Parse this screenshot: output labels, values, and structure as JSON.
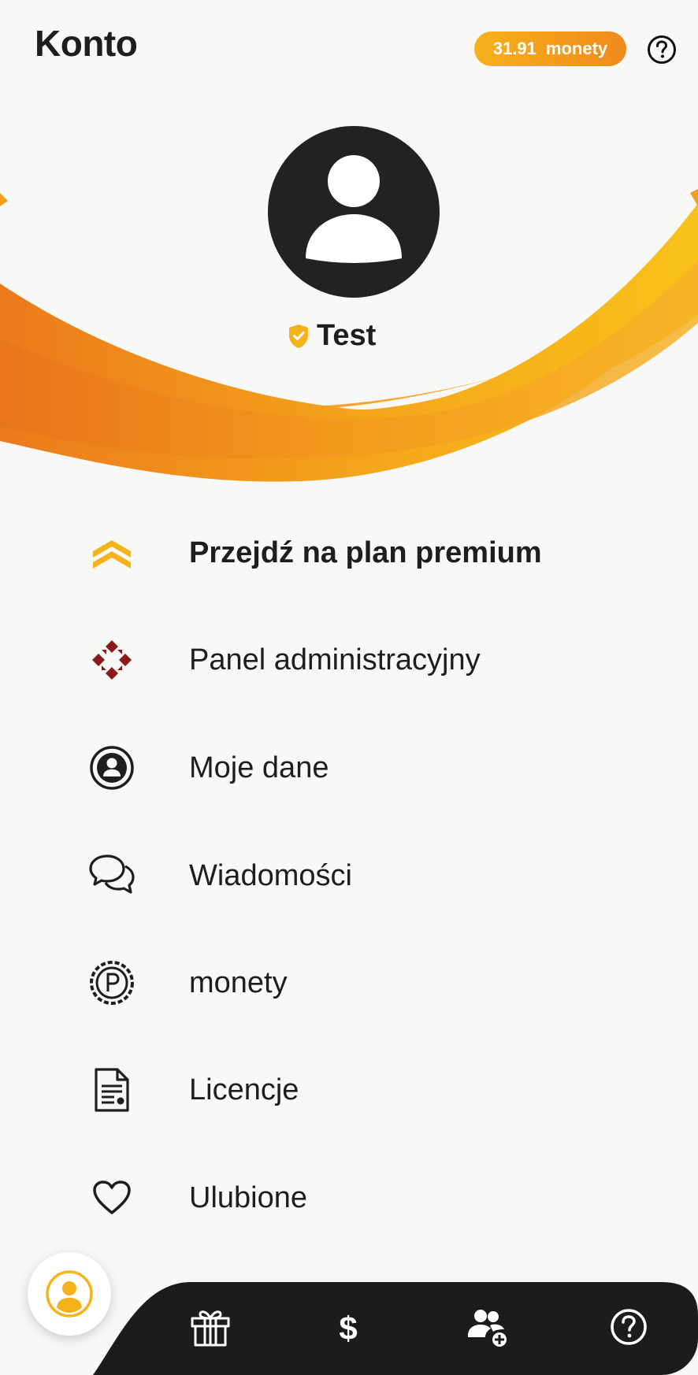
{
  "header": {
    "title": "Konto",
    "coins_value": "31.91",
    "coins_unit": "monety"
  },
  "profile": {
    "name": "Test"
  },
  "menu": {
    "items": [
      {
        "label": "Przejdź na plan premium",
        "icon": "premium-chevrons-icon"
      },
      {
        "label": "Panel administracyjny",
        "icon": "admin-panel-icon"
      },
      {
        "label": "Moje dane",
        "icon": "user-circle-icon"
      },
      {
        "label": "Wiadomości",
        "icon": "chat-bubbles-icon"
      },
      {
        "label": "monety",
        "icon": "coin-icon"
      },
      {
        "label": "Licencje",
        "icon": "document-icon"
      },
      {
        "label": "Ulubione",
        "icon": "heart-icon"
      }
    ]
  },
  "bottom_nav": {
    "items": [
      "account-icon",
      "gift-icon",
      "dollar-icon",
      "add-user-icon",
      "help-icon"
    ]
  },
  "colors": {
    "accent_yellow": "#f7b21b",
    "accent_orange": "#ec7a1c",
    "dark": "#1e1e1e",
    "admin_red": "#8b1a1a"
  }
}
